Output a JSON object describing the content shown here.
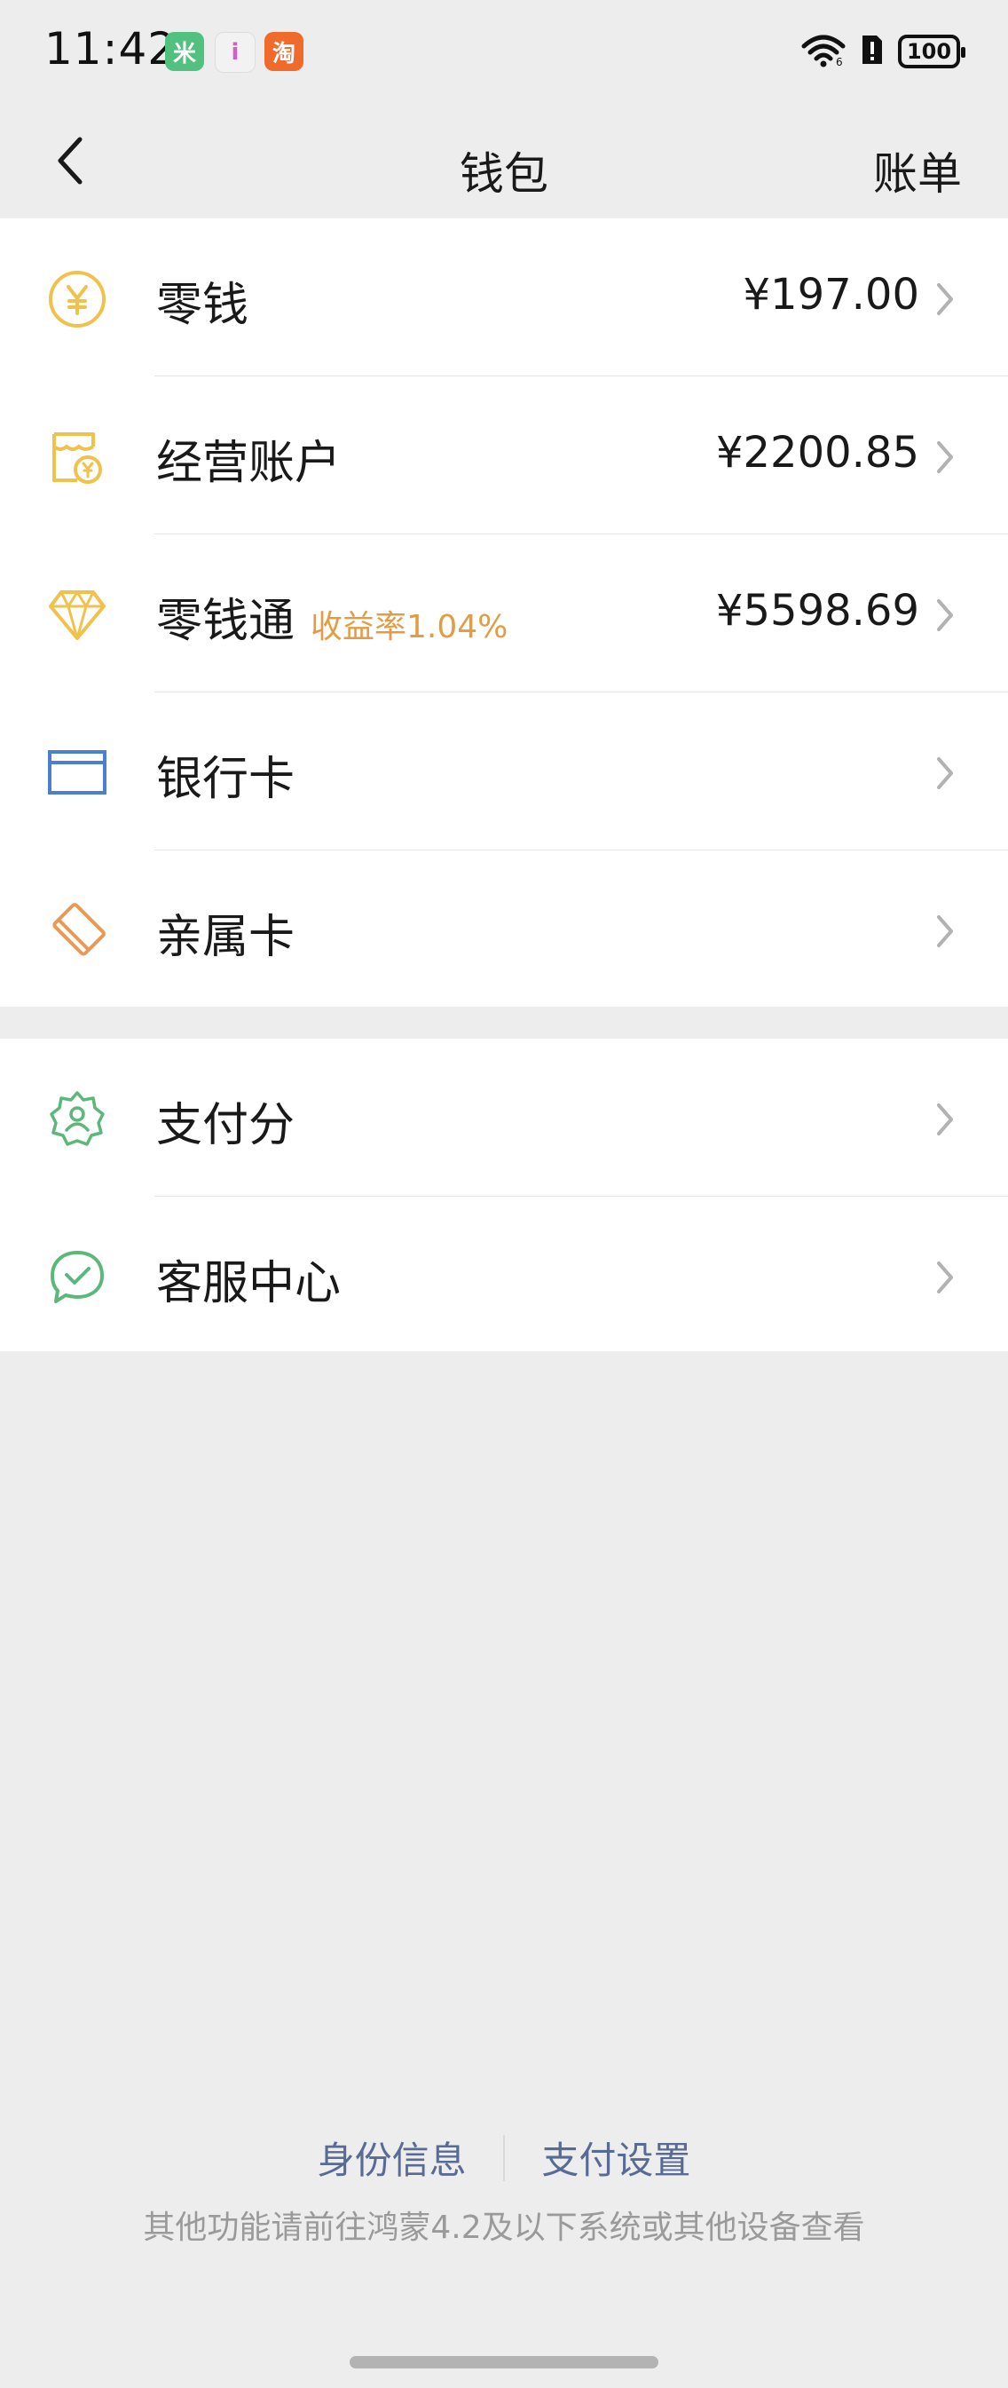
{
  "status_bar": {
    "time": "11:42",
    "app_icons": [
      {
        "name": "mi-home-icon",
        "glyph": "米"
      },
      {
        "name": "ifan-icon",
        "glyph": "i"
      },
      {
        "name": "taobao-icon",
        "glyph": "淘"
      }
    ],
    "battery": "100"
  },
  "nav": {
    "title": "钱包",
    "action": "账单",
    "back_icon": "chevron-left-icon"
  },
  "group1": [
    {
      "name": "change",
      "label": "零钱",
      "tag": "",
      "amount": "¥197.00",
      "icon": "yuan-coin-icon",
      "color": "#f0c24b"
    },
    {
      "name": "business-account",
      "label": "经营账户",
      "tag": "",
      "amount": "¥2200.85",
      "icon": "shop-account-icon",
      "color": "#f0c24b"
    },
    {
      "name": "lingqiantong",
      "label": "零钱通",
      "tag": "收益率1.04%",
      "amount": "¥5598.69",
      "icon": "diamond-icon",
      "color": "#f0c24b"
    },
    {
      "name": "bank-card",
      "label": "银行卡",
      "tag": "",
      "amount": "",
      "icon": "card-icon",
      "color": "#4a7fd4"
    },
    {
      "name": "family-card",
      "label": "亲属卡",
      "tag": "",
      "amount": "",
      "icon": "family-card-icon",
      "color": "#e89a55"
    }
  ],
  "group2": [
    {
      "name": "pay-score",
      "label": "支付分",
      "tag": "",
      "amount": "",
      "icon": "badge-user-icon",
      "color": "#5cb87a"
    },
    {
      "name": "customer-service",
      "label": "客服中心",
      "tag": "",
      "amount": "",
      "icon": "chat-check-icon",
      "color": "#5cb87a"
    }
  ],
  "footer": {
    "link1": "身份信息",
    "link2": "支付设置",
    "note": "其他功能请前往鸿蒙4.2及以下系统或其他设备查看"
  },
  "colors": {
    "background": "#ededed",
    "link": "#576b95",
    "tag": "#e39c43"
  }
}
